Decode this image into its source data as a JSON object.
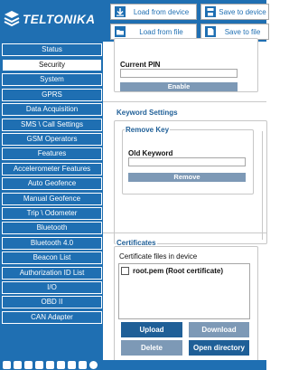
{
  "header": {
    "brand": "TELTONIKA",
    "buttons": {
      "load_device": "Load from device",
      "load_file": "Load from file",
      "save_device": "Save to device",
      "save_file": "Save to file"
    }
  },
  "sidebar": {
    "active": "Security",
    "items": [
      "Status",
      "Security",
      "System",
      "GPRS",
      "Data Acquisition",
      "SMS \\ Call Settings",
      "GSM Operators",
      "Features",
      "Accelerometer Features",
      "Auto Geofence",
      "Manual Geofence",
      "Trip \\ Odometer",
      "Bluetooth",
      "Bluetooth 4.0",
      "Beacon List",
      "Authorization ID List",
      "I/O",
      "OBD II",
      "CAN Adapter"
    ]
  },
  "pin_section": {
    "label": "Current PIN",
    "value": "",
    "enable_label": "Enable"
  },
  "keyword_section": {
    "title": "Keyword Settings",
    "remove_key": {
      "title": "Remove Key",
      "old_keyword_label": "Old Keyword",
      "value": "",
      "remove_label": "Remove"
    }
  },
  "certificates": {
    "title": "Certificates",
    "files_label": "Certificate files in device",
    "files": [
      "root.pem (Root certificate)"
    ],
    "buttons": {
      "upload": "Upload",
      "download": "Download",
      "delete": "Delete",
      "open_directory": "Open directory"
    }
  },
  "colors": {
    "brand_blue": "#1f6fb2",
    "dark_button": "#1f5f97",
    "light_button": "#7d99b6"
  },
  "social_icons": [
    "rss-icon",
    "facebook-icon",
    "linkedin-icon",
    "youtube-icon",
    "twitter-icon",
    "video-icon",
    "linkedin-icon",
    "instagram-icon",
    "info-icon"
  ]
}
